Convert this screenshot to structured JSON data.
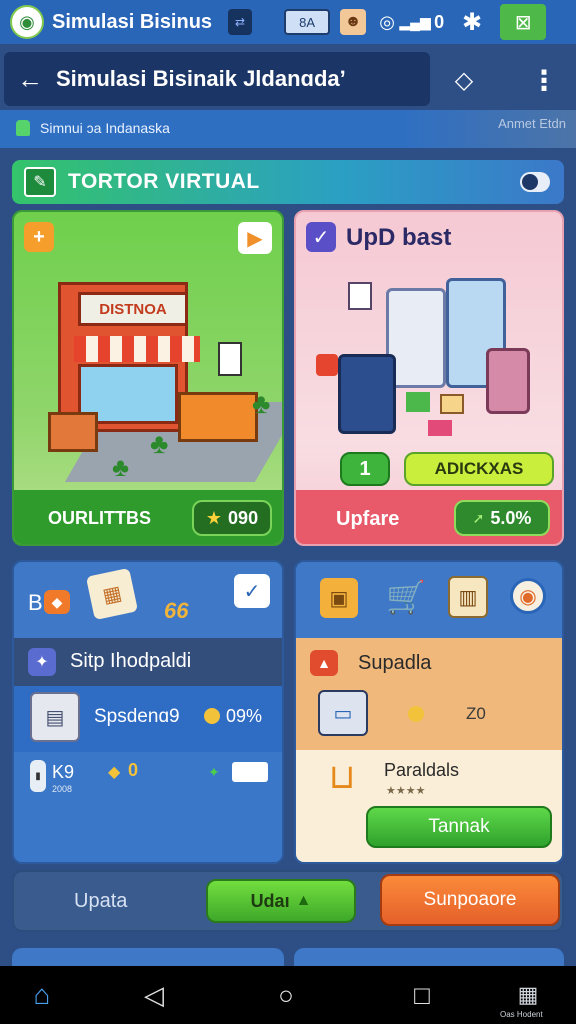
{
  "status_bar": {
    "app_name": "Simulasi Bisinus",
    "badge_label": "8A",
    "signal_value": "0",
    "colors": {
      "bar": "#2a66b8"
    }
  },
  "app_bar": {
    "title": "Simulasi Bisinaik Jldanɑdaʼ",
    "sub_label": "Simnui ɔa Indanaska",
    "right_label": "Anmet Etdn"
  },
  "section": {
    "title": "TORTOR VIRTUAL"
  },
  "cards": {
    "store": {
      "sign_text": "DISTNOA",
      "footer_label": "OURLITTBS",
      "stat_value": "090"
    },
    "update": {
      "title": "UpD bast",
      "count_badge": "1",
      "action_label": "ADICKXAS",
      "footer_label": "Upfare",
      "stat_value": "5.0%"
    },
    "stats": {
      "header_prefix": "B",
      "header_value": "66",
      "panel_title": "Sitp Ihodpaldi",
      "row1_label": "Spsdenɑ9",
      "row1_value": "09%",
      "row2_label": "K9",
      "row2_sub": "2008",
      "row2_value": "0"
    },
    "supplies": {
      "panel_title": "Supadla",
      "row1_value": "Z0",
      "row2_label": "Paraldals",
      "row2_stars": "★★★★",
      "action_label": "Tannak"
    }
  },
  "bottom_bar": {
    "left_label": "Upata",
    "middle_label": "Udaı",
    "right_label": "Sunpoaore"
  },
  "nav_bar": {
    "corner_label": "Oas Hodent"
  }
}
